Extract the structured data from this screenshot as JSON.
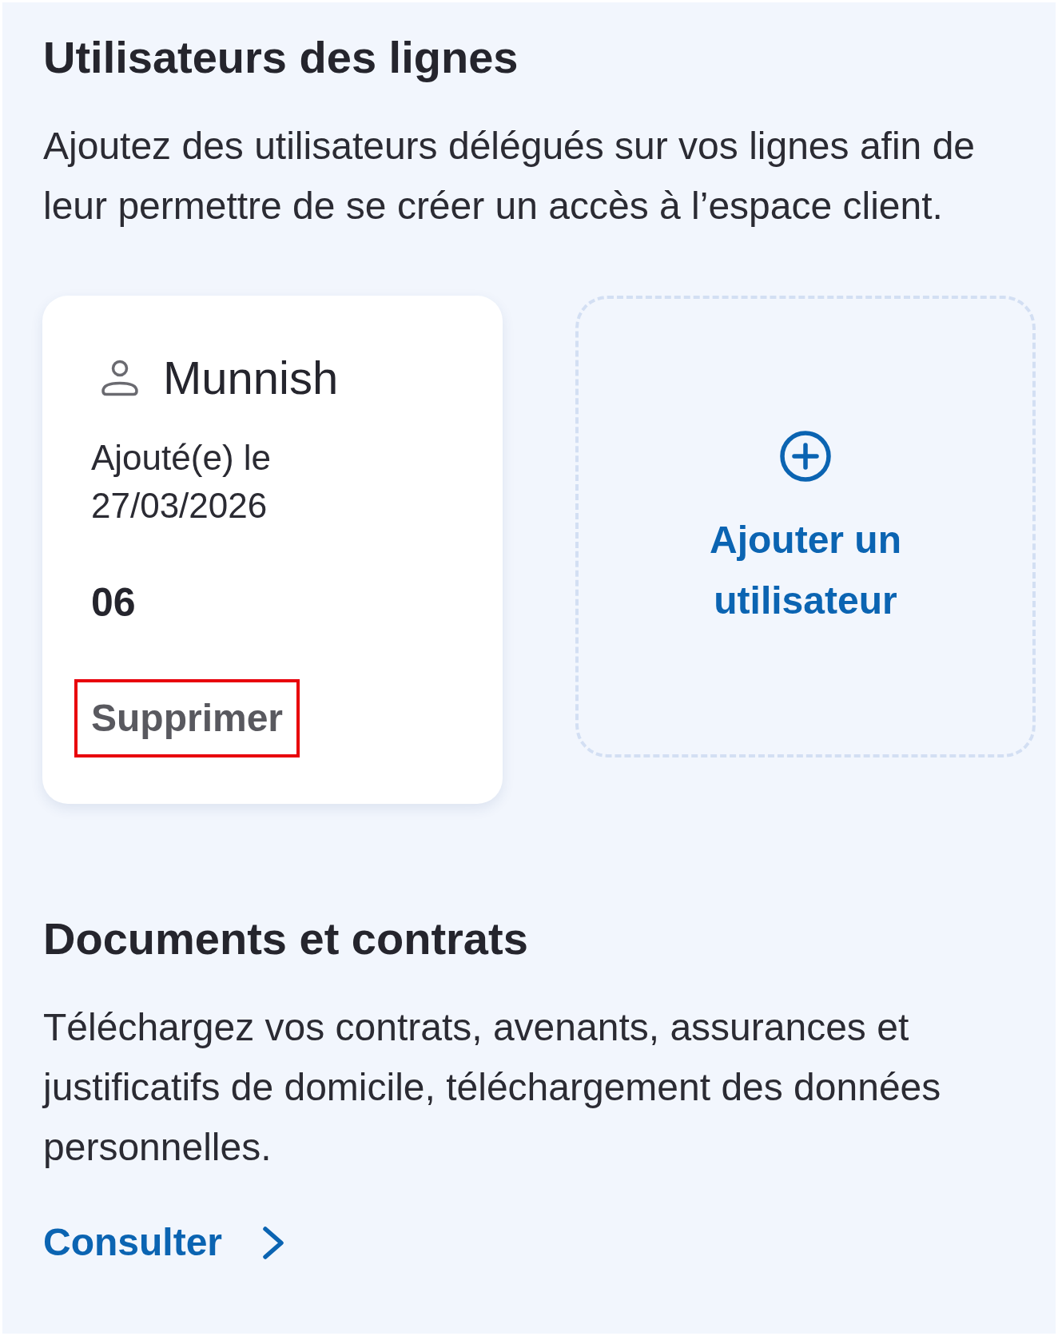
{
  "users_section": {
    "title": "Utilisateurs des lignes",
    "description": "Ajoutez des utilisateurs délégués sur vos lignes afin de leur permettre de se créer un accès à l’espace client.",
    "users": [
      {
        "name": "Munnish",
        "added": "Ajouté(e) le 27/03/2026",
        "line": "06",
        "remove_action": {
          "label": "Supprimer",
          "highlighted": true
        }
      }
    ],
    "add_user": {
      "label": "Ajouter un utilisateur"
    }
  },
  "documents_section": {
    "title": "Documents et contrats",
    "description": "Téléchargez vos contrats, avenants, assurances et justificatifs de domicile, téléchargement des données personnelles.",
    "link": {
      "label": "Consulter"
    }
  }
}
